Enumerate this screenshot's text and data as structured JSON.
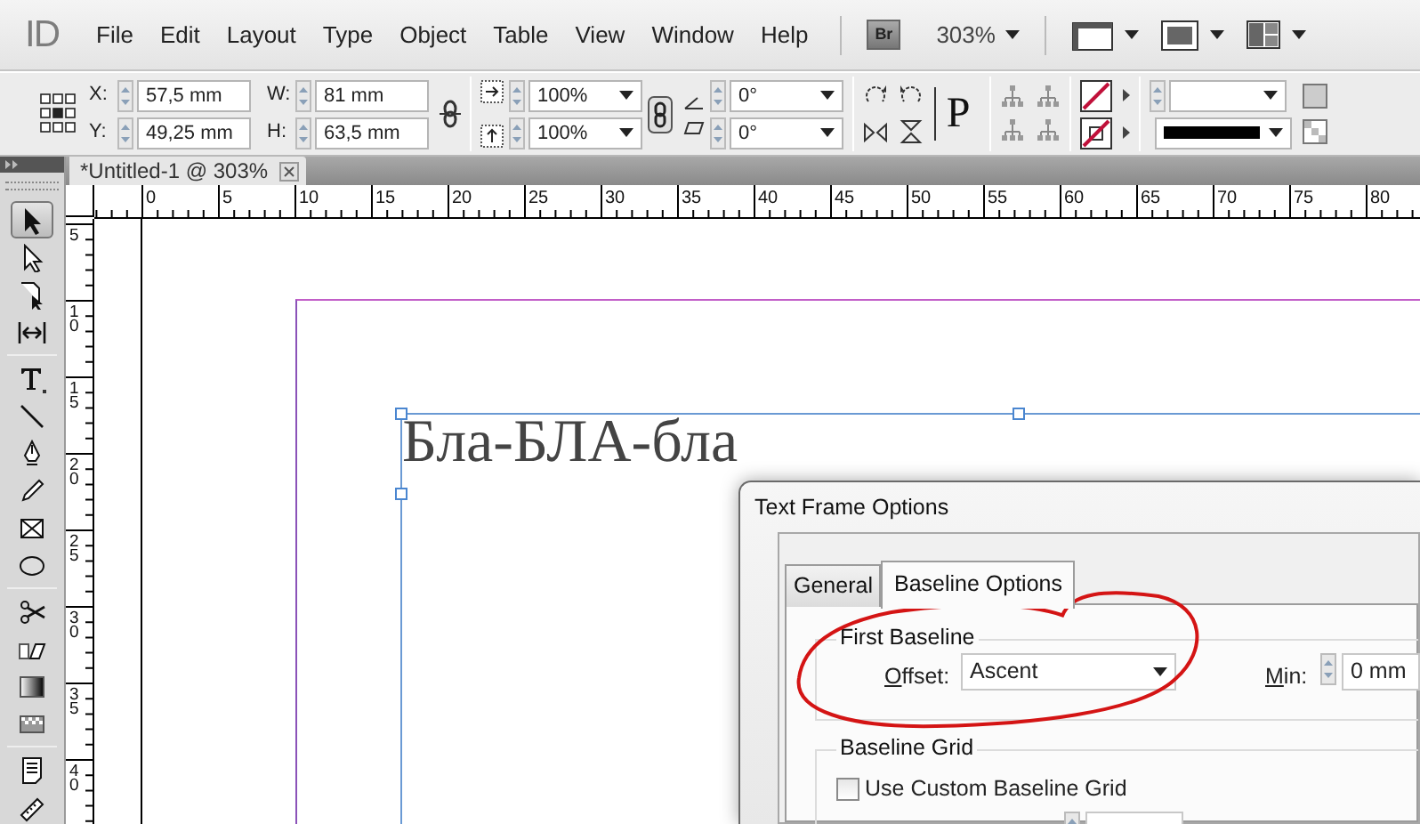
{
  "app_logo": "ID",
  "menu": [
    "File",
    "Edit",
    "Layout",
    "Type",
    "Object",
    "Table",
    "View",
    "Window",
    "Help"
  ],
  "app_bar": {
    "bridge": "Br",
    "zoom": "303%"
  },
  "control_panel": {
    "position_fields": [
      {
        "label": "X:",
        "value": "57,5 mm"
      },
      {
        "label": "Y:",
        "value": "49,25 mm"
      },
      {
        "label": "W:",
        "value": "81 mm"
      },
      {
        "label": "H:",
        "value": "63,5 mm"
      }
    ],
    "scale_fields": [
      "100%",
      "100%"
    ],
    "angle_fields": [
      "0°",
      "0°"
    ],
    "container_glyph": "P"
  },
  "document_tab": {
    "title": "*Untitled-1 @ 303%"
  },
  "rulers": {
    "horizontal": [
      "0",
      "5",
      "10",
      "15",
      "20",
      "25",
      "30",
      "35",
      "40",
      "45",
      "50",
      "55",
      "60",
      "65",
      "70",
      "75",
      "80"
    ],
    "vertical": [
      "5",
      "10",
      "15",
      "20",
      "25",
      "30",
      "35",
      "40"
    ]
  },
  "tool_groups": [
    [
      {
        "kind": "selection",
        "selected": true
      },
      {
        "kind": "direct",
        "selected": false
      },
      {
        "kind": "page",
        "selected": false
      },
      {
        "kind": "gap",
        "selected": false
      }
    ],
    [
      {
        "kind": "type",
        "selected": false
      },
      {
        "kind": "line",
        "selected": false
      },
      {
        "kind": "pen",
        "selected": false
      },
      {
        "kind": "pencil",
        "selected": false
      },
      {
        "kind": "frame",
        "selected": false
      },
      {
        "kind": "ellipse",
        "selected": false
      }
    ],
    [
      {
        "kind": "scissors",
        "selected": false
      },
      {
        "kind": "transform",
        "selected": false
      },
      {
        "kind": "gradient",
        "selected": false
      },
      {
        "kind": "feather",
        "selected": false
      }
    ],
    [
      {
        "kind": "note",
        "selected": false
      },
      {
        "kind": "measure",
        "selected": false
      }
    ]
  ],
  "canvas": {
    "text": "Бла-БЛА-бла"
  },
  "dialog": {
    "title": "Text Frame Options",
    "tabs": [
      {
        "label": "General",
        "selected": false
      },
      {
        "label": "Baseline Options",
        "selected": true
      }
    ],
    "first_baseline": {
      "title": "First Baseline",
      "offset_label": "Offset:",
      "offset_value": "Ascent",
      "min_label": "Min:",
      "min_value": "0 mm"
    },
    "baseline_grid": {
      "title": "Baseline Grid",
      "checkbox": {
        "label": "Use Custom Baseline Grid",
        "checked": false
      }
    }
  }
}
